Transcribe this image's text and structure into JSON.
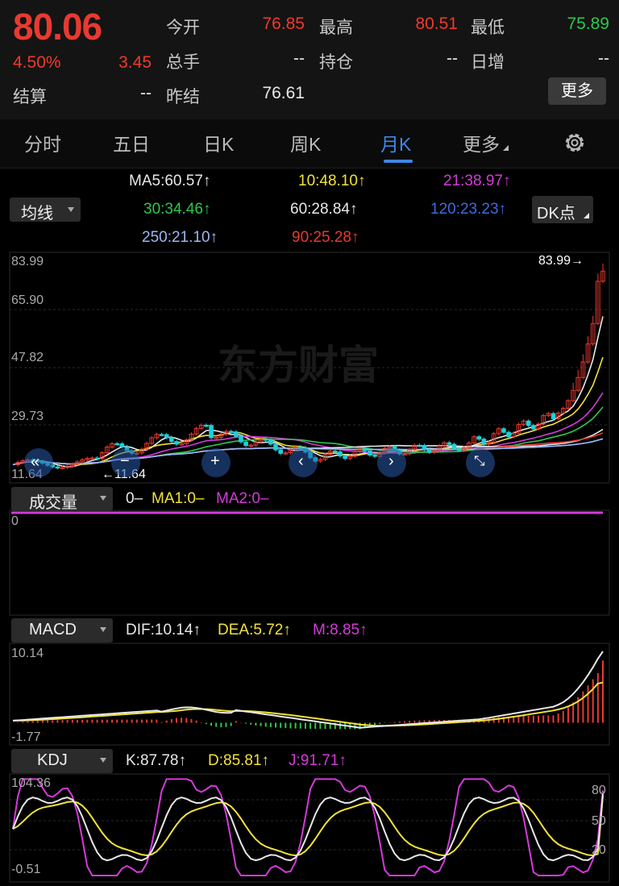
{
  "quote": {
    "price": "80.06",
    "change_pct": "4.50%",
    "change": "3.45",
    "fields": [
      {
        "label": "今开",
        "value": "76.85",
        "color": "#f0392b"
      },
      {
        "label": "最高",
        "value": "80.51",
        "color": "#f0392b"
      },
      {
        "label": "最低",
        "value": "75.89",
        "color": "#2ec84b"
      },
      {
        "label": "总手",
        "value": "--",
        "color": "#e8e8e8"
      },
      {
        "label": "持仓",
        "value": "--",
        "color": "#e8e8e8"
      },
      {
        "label": "日增",
        "value": "--",
        "color": "#e8e8e8"
      },
      {
        "label": "结算",
        "value": "--",
        "color": "#e8e8e8"
      },
      {
        "label": "昨结",
        "value": "76.61",
        "color": "#e8e8e8"
      }
    ],
    "more_button": "更多"
  },
  "tabs": [
    "分时",
    "五日",
    "日K",
    "周K",
    "月K",
    "更多"
  ],
  "active_tab": "月K",
  "ma_panel": {
    "dropdown": "均线",
    "dk_button": "DK点",
    "items": [
      {
        "text": "MA5:60.57",
        "color": "#e8e8e8"
      },
      {
        "text": "10:48.10",
        "color": "#f2e23a"
      },
      {
        "text": "21:38.97",
        "color": "#d43ad9"
      },
      {
        "text": "30:34.46",
        "color": "#2ec84b"
      },
      {
        "text": "60:28.84",
        "color": "#e8e8e8"
      },
      {
        "text": "120:23.23",
        "color": "#3c6ce0"
      },
      {
        "text": "250:21.10",
        "color": "#9ab8f0"
      },
      {
        "text": "90:25.28",
        "color": "#e83a30"
      }
    ],
    "arrow": "↑"
  },
  "main_chart": {
    "y_labels": [
      "83.99",
      "65.90",
      "47.82",
      "29.73",
      "11.64"
    ],
    "high_marker": "83.99→",
    "low_marker": "←11.64",
    "watermark": "东方财富"
  },
  "volume": {
    "dropdown": "成交量",
    "legend": [
      {
        "text": "0–",
        "color": "#e8e8e8"
      },
      {
        "text": "MA1:0–",
        "color": "#f2e23a"
      },
      {
        "text": "MA2:0–",
        "color": "#d43ad9"
      }
    ],
    "y_label": "0"
  },
  "macd": {
    "dropdown": "MACD",
    "legend": [
      {
        "text": "DIF:10.14",
        "color": "#e8e8e8"
      },
      {
        "text": "DEA:5.72",
        "color": "#f2e23a"
      },
      {
        "text": "M:8.85",
        "color": "#d43ad9"
      }
    ],
    "y_top": "10.14",
    "y_bottom": "-1.77"
  },
  "kdj": {
    "dropdown": "KDJ",
    "legend": [
      {
        "text": "K:87.78",
        "color": "#e8e8e8"
      },
      {
        "text": "D:85.81",
        "color": "#f2e23a"
      },
      {
        "text": "J:91.71",
        "color": "#d43ad9"
      }
    ],
    "y_top": "104.36",
    "y_bottom": "-0.51",
    "levels": [
      "80",
      "50",
      "20"
    ]
  },
  "colors": {
    "up": "#e83a30",
    "down": "#1fd0d8",
    "grid": "#2a2a2a"
  }
}
